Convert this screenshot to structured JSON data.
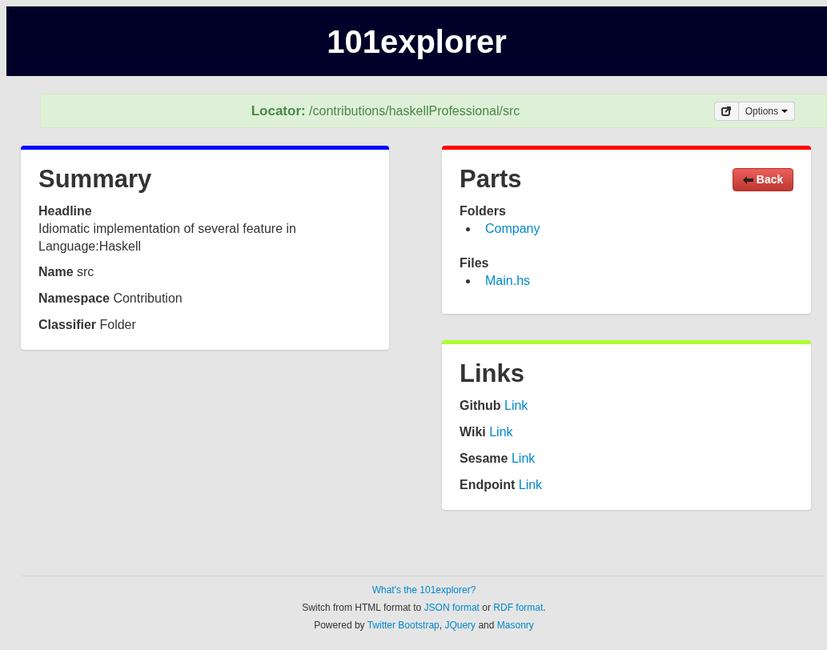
{
  "header": {
    "title": "101explorer"
  },
  "locator": {
    "label": "Locator:",
    "path": "/contributions/haskellProfessional/src",
    "options_button": "Options"
  },
  "summary": {
    "title": "Summary",
    "color": "#0000ff",
    "headline_label": "Headline",
    "headline": "Idiomatic implementation of several feature in Language:Haskell",
    "fields": [
      {
        "label": "Name",
        "value": "src"
      },
      {
        "label": "Namespace",
        "value": "Contribution"
      },
      {
        "label": "Classifier",
        "value": "Folder"
      }
    ]
  },
  "parts": {
    "title": "Parts",
    "color": "#ff0000",
    "back_button": "Back",
    "groups": [
      {
        "label": "Folders",
        "items": [
          "Company"
        ]
      },
      {
        "label": "Files",
        "items": [
          "Main.hs"
        ]
      }
    ]
  },
  "links": {
    "title": "Links",
    "color": "#adff2f",
    "items": [
      {
        "label": "Github",
        "link": "Link"
      },
      {
        "label": "Wiki",
        "link": "Link"
      },
      {
        "label": "Sesame",
        "link": "Link"
      },
      {
        "label": "Endpoint",
        "link": "Link"
      }
    ]
  },
  "footer": {
    "lines": [
      [
        {
          "kind": "link",
          "text": "What's the 101explorer?"
        }
      ],
      [
        {
          "kind": "text",
          "text": "Switch from HTML format to "
        },
        {
          "kind": "link",
          "text": "JSON format"
        },
        {
          "kind": "text",
          "text": " or "
        },
        {
          "kind": "link",
          "text": "RDF format"
        },
        {
          "kind": "text",
          "text": "."
        }
      ],
      [
        {
          "kind": "text",
          "text": "Powered by "
        },
        {
          "kind": "link",
          "text": "Twitter Bootstrap"
        },
        {
          "kind": "text",
          "text": ", "
        },
        {
          "kind": "link",
          "text": "JQuery"
        },
        {
          "kind": "text",
          "text": " and "
        },
        {
          "kind": "link",
          "text": "Masonry"
        }
      ]
    ]
  }
}
